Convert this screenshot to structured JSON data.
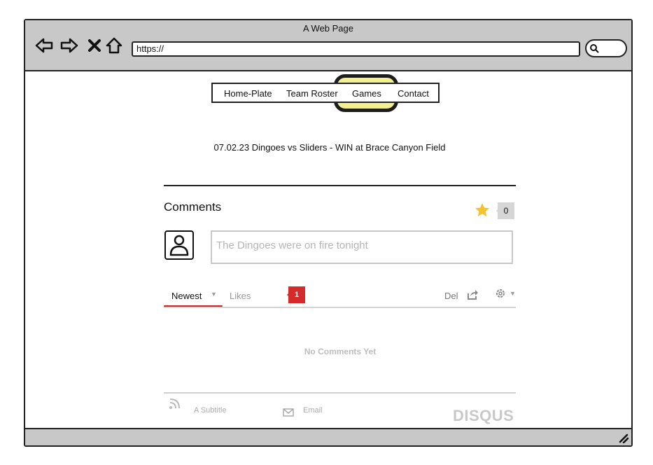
{
  "window": {
    "title": "A Web Page"
  },
  "browser": {
    "url": "https://"
  },
  "menu": {
    "items": [
      "Home-Plate",
      "Team Roster",
      "Games",
      "Contact"
    ],
    "highlight_color": "#f5f08a"
  },
  "game": {
    "title": "07.02.23 Dingoes vs Sliders - WIN at Brace Canyon Field"
  },
  "comments": {
    "heading": "Comments",
    "star_count": "0",
    "placeholder": "The Dingoes were on fire tonight",
    "tabs": {
      "newest": "Newest",
      "likes": "Likes"
    },
    "badge_count": "1",
    "del_label": "Del",
    "empty_text": "No Comments Yet",
    "footer": {
      "subtitle": "A Subtitle",
      "email": "Email",
      "brand": "DISQUS"
    }
  },
  "colors": {
    "chrome": "#c8c8c8",
    "badge": "#d52a2a",
    "star": "#f6c12c",
    "accent_underline": "#cc2222"
  }
}
